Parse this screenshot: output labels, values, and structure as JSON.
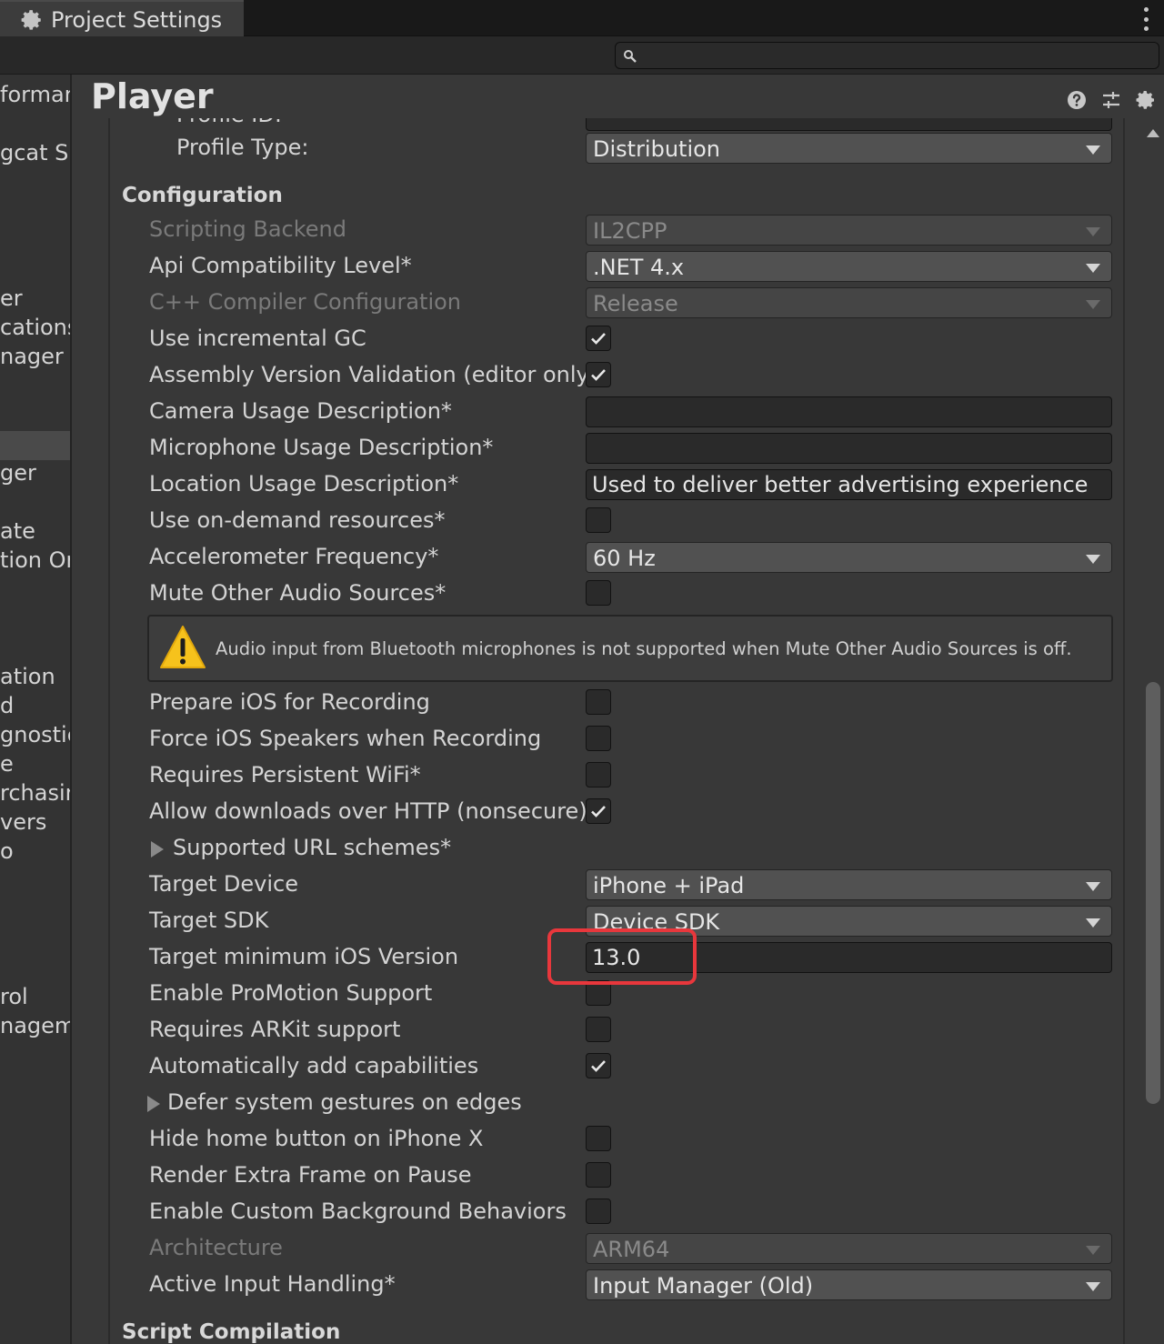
{
  "window": {
    "tab_title": "Project Settings",
    "tab_icon": "gear-icon",
    "menu_icon": "kebab-menu-icon"
  },
  "search": {
    "placeholder": "",
    "icon": "search-icon"
  },
  "sidebar": {
    "items": [
      "forman",
      "gcat S",
      "er",
      "cations",
      "nager",
      "ger",
      "ate",
      "tion Ord",
      "ation",
      "d",
      "gnostic",
      "e",
      "rchasin",
      "vers",
      "o",
      "rol",
      "nagem"
    ]
  },
  "header": {
    "title": "Player",
    "icons": [
      "help-icon",
      "preset-sliders-icon",
      "settings-gear-icon"
    ]
  },
  "settings": {
    "profile_id_label": "Profile ID:",
    "profile_type": {
      "label": "Profile Type:",
      "value": "Distribution"
    },
    "configuration_header": "Configuration",
    "scripting_backend": {
      "label": "Scripting Backend",
      "value": "IL2CPP",
      "disabled": true
    },
    "api_compat": {
      "label": "Api Compatibility Level*",
      "value": ".NET 4.x"
    },
    "cpp_compiler": {
      "label": "C++ Compiler Configuration",
      "value": "Release",
      "disabled": true
    },
    "incremental_gc": {
      "label": "Use incremental GC",
      "checked": true
    },
    "assembly_validation": {
      "label": "Assembly Version Validation (editor only)",
      "checked": true
    },
    "camera_usage": {
      "label": "Camera Usage Description*",
      "value": ""
    },
    "microphone_usage": {
      "label": "Microphone Usage Description*",
      "value": ""
    },
    "location_usage": {
      "label": "Location Usage Description*",
      "value": "Used to deliver better advertising experience"
    },
    "on_demand": {
      "label": "Use on-demand resources*",
      "checked": false
    },
    "accelerometer": {
      "label": "Accelerometer Frequency*",
      "value": "60 Hz"
    },
    "mute_audio": {
      "label": "Mute Other Audio Sources*",
      "checked": false
    },
    "warning": {
      "icon": "warning-triangle-icon",
      "text": "Audio input from Bluetooth microphones is not supported when Mute Other Audio Sources is off."
    },
    "prepare_recording": {
      "label": "Prepare iOS for Recording",
      "checked": false
    },
    "force_speakers": {
      "label": "Force iOS Speakers when Recording",
      "checked": false
    },
    "persistent_wifi": {
      "label": "Requires Persistent WiFi*",
      "checked": false
    },
    "allow_http": {
      "label": "Allow downloads over HTTP (nonsecure)*",
      "checked": true
    },
    "url_schemes": {
      "label": "Supported URL schemes*"
    },
    "target_device": {
      "label": "Target Device",
      "value": "iPhone + iPad"
    },
    "target_sdk": {
      "label": "Target SDK",
      "value": "Device SDK"
    },
    "min_ios": {
      "label": "Target minimum iOS Version",
      "value": "13.0"
    },
    "promotion": {
      "label": "Enable ProMotion Support",
      "checked": false
    },
    "arkit": {
      "label": "Requires ARKit support",
      "checked": false
    },
    "auto_capabilities": {
      "label": "Automatically add capabilities",
      "checked": true
    },
    "defer_gestures": {
      "label": "Defer system gestures on edges"
    },
    "hide_home": {
      "label": "Hide home button on iPhone X",
      "checked": false
    },
    "extra_frame": {
      "label": "Render Extra Frame on Pause",
      "checked": false
    },
    "custom_bg": {
      "label": "Enable Custom Background Behaviors",
      "checked": false
    },
    "architecture": {
      "label": "Architecture",
      "value": "ARM64",
      "disabled": true
    },
    "input_handling": {
      "label": "Active Input Handling*",
      "value": "Input Manager (Old)"
    },
    "script_compilation_header": "Script Compilation"
  },
  "highlight_color": "#e8373c"
}
